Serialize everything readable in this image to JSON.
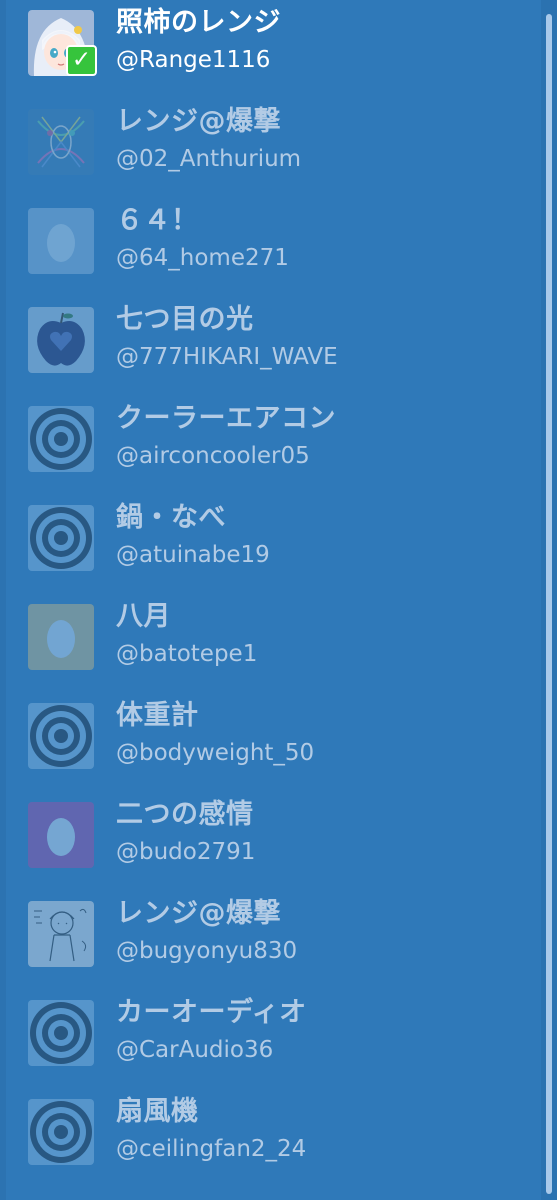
{
  "accounts": [
    {
      "display_name": "照柿のレンジ",
      "handle": "@Range1116",
      "active": true,
      "avatar": "anime-girl-avatar"
    },
    {
      "display_name": "レンジ@爆撃",
      "handle": "@02_Anthurium",
      "active": false,
      "avatar": "abstract-art-avatar"
    },
    {
      "display_name": "６４！",
      "handle": "@64_home271",
      "active": false,
      "avatar": "default-egg-avatar"
    },
    {
      "display_name": "七つ目の光",
      "handle": "@777HIKARI_WAVE",
      "active": false,
      "avatar": "apple-heart-avatar"
    },
    {
      "display_name": "クーラーエアコン",
      "handle": "@airconcooler05",
      "active": false,
      "avatar": "target-circles-avatar"
    },
    {
      "display_name": "鍋・なべ",
      "handle": "@atuinabe19",
      "active": false,
      "avatar": "target-circles-avatar"
    },
    {
      "display_name": "八月",
      "handle": "@batotepe1",
      "active": false,
      "avatar": "default-egg-avatar"
    },
    {
      "display_name": "体重計",
      "handle": "@bodyweight_50",
      "active": false,
      "avatar": "target-circles-avatar"
    },
    {
      "display_name": "二つの感情",
      "handle": "@budo2791",
      "active": false,
      "avatar": "default-egg-avatar"
    },
    {
      "display_name": "レンジ@爆撃",
      "handle": "@bugyonyu830",
      "active": false,
      "avatar": "sketch-drawing-avatar"
    },
    {
      "display_name": "カーオーディオ",
      "handle": "@CarAudio36",
      "active": false,
      "avatar": "target-circles-avatar"
    },
    {
      "display_name": "扇風機",
      "handle": "@ceilingfan2_24",
      "active": false,
      "avatar": "target-circles-avatar"
    }
  ],
  "colors": {
    "background": "#2f79b9",
    "inactive_text": "#b2cbe5",
    "active_text": "#ffffff",
    "check_badge": "#36c43c"
  },
  "icons": {
    "active_check": "check-icon"
  },
  "badges": {
    "active_check_glyph": "✓"
  }
}
